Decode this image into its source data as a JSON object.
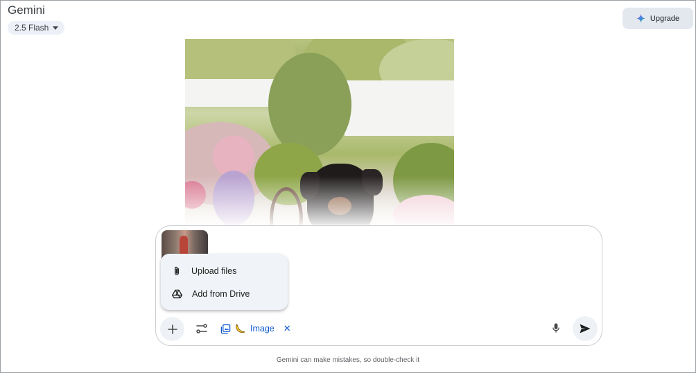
{
  "header": {
    "app_title": "Gemini",
    "model_label": "2.5 Flash",
    "upgrade_label": "Upgrade"
  },
  "upload_menu": {
    "items": [
      {
        "label": "Upload files",
        "icon": "paperclip-icon"
      },
      {
        "label": "Add from Drive",
        "icon": "drive-icon"
      }
    ]
  },
  "toolbar": {
    "image_chip_label": "Image",
    "image_chip_close": "✕"
  },
  "footer": {
    "disclaimer": "Gemini can make mistakes, so double-check it"
  },
  "colors": {
    "accent": "#0b57d0",
    "chip_bg": "#eef1f5",
    "menu_bg": "#f0f4f9",
    "upgrade_bg": "#e3e8ef"
  }
}
